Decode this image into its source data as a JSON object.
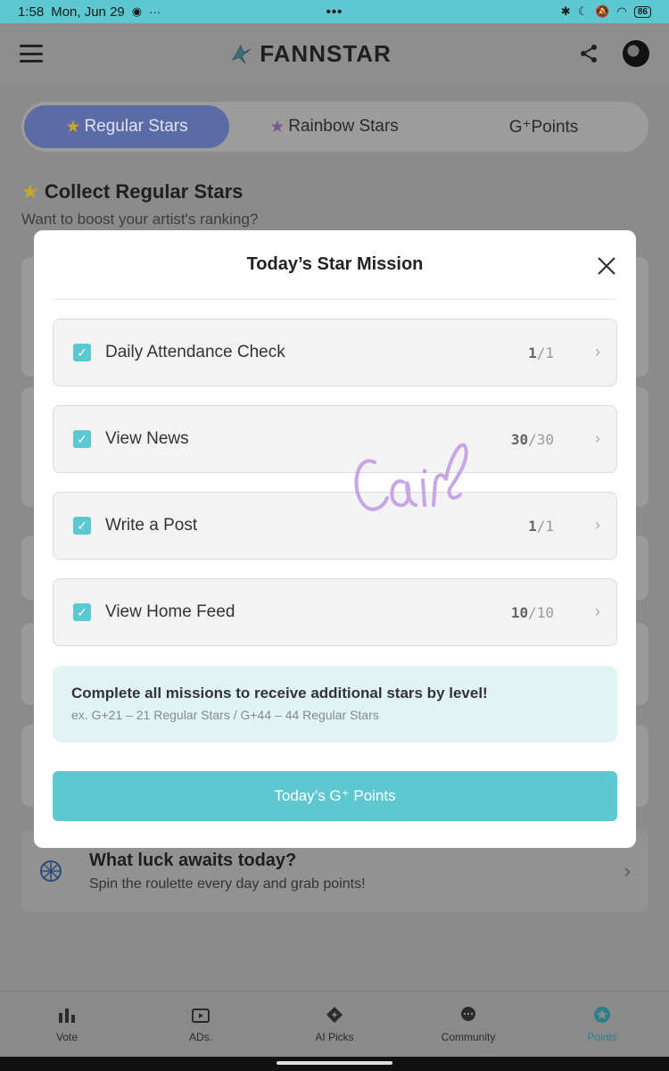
{
  "status_bar": {
    "time": "1:58",
    "date": "Mon, Jun 29",
    "center": "•••",
    "battery": "86"
  },
  "header": {
    "logo_text": "FANNSTAR"
  },
  "tabs": [
    {
      "label": "Regular Stars"
    },
    {
      "label": "Rainbow Stars"
    },
    {
      "label": "G⁺Points"
    }
  ],
  "section": {
    "title": "Collect Regular Stars",
    "subtitle": "Want to boost your artist's ranking?"
  },
  "luck_card": {
    "title": "What luck awaits today?",
    "subtitle": "Spin the roulette every day and grab points!"
  },
  "bottom_nav": [
    {
      "label": "Vote"
    },
    {
      "label": "ADs."
    },
    {
      "label": "AI Picks"
    },
    {
      "label": "Community"
    },
    {
      "label": "Points"
    }
  ],
  "modal": {
    "title": "Today’s Star Mission",
    "missions": [
      {
        "label": "Daily Attendance Check",
        "done": "1",
        "total": "/1"
      },
      {
        "label": "View News",
        "done": "30",
        "total": "/30"
      },
      {
        "label": "Write a Post",
        "done": "1",
        "total": "/1"
      },
      {
        "label": "View Home Feed",
        "done": "10",
        "total": "/10"
      }
    ],
    "info_title": "Complete all missions to receive additional stars by level!",
    "info_sub": "ex. G+21 – 21 Regular Stars / G+44 – 44 Regular Stars",
    "button_label": "Today’s  G⁺ Points"
  },
  "colors": {
    "accent": "#5ec8d0",
    "active_tab": "#5b6ba5",
    "info_bg": "#e0f4f6"
  }
}
